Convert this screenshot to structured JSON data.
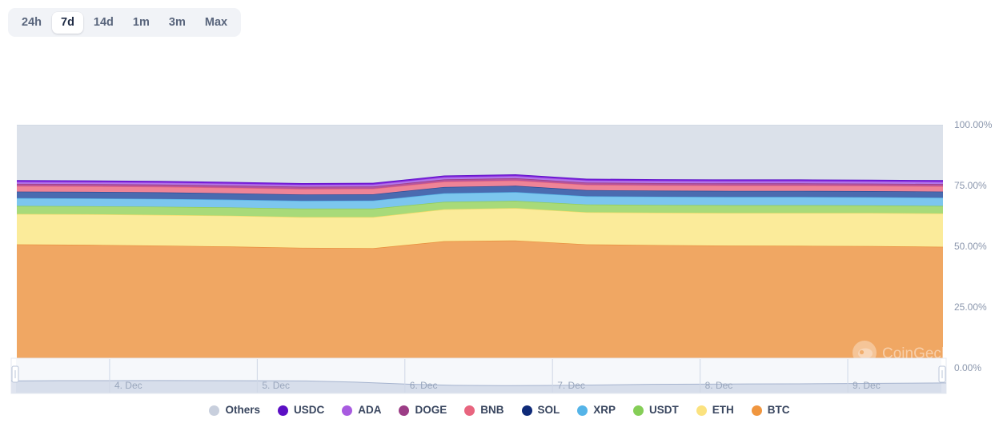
{
  "range_selector": {
    "options": [
      {
        "label": "24h",
        "active": false
      },
      {
        "label": "7d",
        "active": true
      },
      {
        "label": "14d",
        "active": false
      },
      {
        "label": "1m",
        "active": false
      },
      {
        "label": "3m",
        "active": false
      },
      {
        "label": "Max",
        "active": false
      }
    ]
  },
  "watermark": {
    "text": "CoinGecko",
    "icon": "gecko-logo-icon"
  },
  "navigator": {
    "x_labels": [
      "4. Dec",
      "5. Dec",
      "6. Dec",
      "7. Dec",
      "8. Dec",
      "9. Dec"
    ],
    "left_handle": "navigator-left-handle",
    "right_handle": "navigator-right-handle",
    "series_values": [
      76,
      76.3,
      76.4,
      76.5,
      76.4,
      76.2,
      76.0,
      74.5,
      72.0,
      70.4,
      70.0,
      70.2,
      70.9,
      71.6,
      71.9,
      72.1,
      72.3,
      72.6,
      73.0,
      73.4
    ],
    "fill_color": "#dfe4ef",
    "line_color": "#a9b6d0"
  },
  "legend": {
    "items": [
      {
        "label": "Others",
        "color": "#c8cfdd"
      },
      {
        "label": "USDC",
        "color": "#5b0fc4"
      },
      {
        "label": "ADA",
        "color": "#a85be0"
      },
      {
        "label": "DOGE",
        "color": "#9c3d86"
      },
      {
        "label": "BNB",
        "color": "#e8657f"
      },
      {
        "label": "SOL",
        "color": "#0f2a78"
      },
      {
        "label": "XRP",
        "color": "#55b4e8"
      },
      {
        "label": "USDT",
        "color": "#85ce57"
      },
      {
        "label": "ETH",
        "color": "#fbe27f"
      },
      {
        "label": "BTC",
        "color": "#f0963f"
      }
    ]
  },
  "chart_data": {
    "type": "area",
    "title": "",
    "subtitle": "",
    "xlabel": "",
    "ylabel": "",
    "stacked": true,
    "stack_mode": "percent",
    "grid": false,
    "legend_position": "bottom",
    "ylim": [
      0,
      100
    ],
    "y_ticks": [
      0,
      25,
      50,
      75,
      100
    ],
    "y_tick_labels": [
      "0.00%",
      "25.00%",
      "50.00%",
      "75.00%",
      "100.00%"
    ],
    "x_tick_labels": [
      "4. Dec",
      "5. Dec",
      "6. Dec",
      "7. Dec",
      "8. Dec",
      "9. Dec"
    ],
    "x": [
      "3. Dec",
      "3. Dec 12:00",
      "4. Dec",
      "4. Dec 12:00",
      "5. Dec",
      "5. Dec 12:00",
      "6. Dec",
      "6. Dec 12:00",
      "7. Dec",
      "7. Dec 12:00",
      "8. Dec",
      "8. Dec 12:00",
      "9. Dec",
      "9. Dec 12:00"
    ],
    "series": [
      {
        "name": "BTC",
        "color": "#f0a763",
        "stroke": "#e88f3c",
        "values": [
          50.8,
          50.6,
          50.3,
          49.9,
          49.4,
          49.2,
          52.1,
          52.4,
          50.8,
          50.5,
          50.3,
          50.2,
          50.1,
          49.8
        ]
      },
      {
        "name": "ETH",
        "color": "#fbeb9a",
        "stroke": "#f5dc6a",
        "values": [
          12.5,
          12.6,
          12.6,
          12.7,
          12.6,
          12.8,
          13.1,
          13.3,
          13.2,
          13.3,
          13.4,
          13.5,
          13.6,
          13.7
        ]
      },
      {
        "name": "USDT",
        "color": "#a8da79",
        "stroke": "#8fcc57",
        "values": [
          3.3,
          3.3,
          3.4,
          3.4,
          3.5,
          3.5,
          3.1,
          3.0,
          3.2,
          3.2,
          3.2,
          3.2,
          3.1,
          3.1
        ]
      },
      {
        "name": "XRP",
        "color": "#7cc6ee",
        "stroke": "#54b2e6",
        "values": [
          3.2,
          3.2,
          3.2,
          3.2,
          3.2,
          3.3,
          3.5,
          3.6,
          3.4,
          3.4,
          3.4,
          3.4,
          3.4,
          3.4
        ]
      },
      {
        "name": "SOL",
        "color": "#4a6bb0",
        "stroke": "#2c4a96",
        "values": [
          2.7,
          2.7,
          2.7,
          2.6,
          2.6,
          2.6,
          2.6,
          2.6,
          2.5,
          2.5,
          2.5,
          2.5,
          2.5,
          2.5
        ]
      },
      {
        "name": "BNB",
        "color": "#ee8497",
        "stroke": "#e8657f",
        "values": [
          2.3,
          2.3,
          2.3,
          2.3,
          2.3,
          2.3,
          2.2,
          2.2,
          2.2,
          2.2,
          2.2,
          2.2,
          2.2,
          2.2
        ]
      },
      {
        "name": "DOGE",
        "color": "#b5559c",
        "stroke": "#9c3d86",
        "values": [
          0.9,
          0.9,
          0.9,
          0.9,
          0.9,
          0.9,
          0.9,
          0.9,
          0.9,
          0.9,
          0.9,
          0.9,
          0.9,
          0.9
        ]
      },
      {
        "name": "ADA",
        "color": "#b276e8",
        "stroke": "#a85be0",
        "values": [
          0.8,
          0.8,
          0.8,
          0.8,
          0.8,
          0.8,
          0.9,
          0.9,
          0.9,
          0.9,
          0.9,
          0.9,
          0.9,
          0.9
        ]
      },
      {
        "name": "USDC",
        "color": "#7a20dc",
        "stroke": "#5b0fc4",
        "values": [
          0.7,
          0.7,
          0.7,
          0.7,
          0.7,
          0.7,
          0.7,
          0.7,
          0.7,
          0.7,
          0.7,
          0.7,
          0.7,
          0.7
        ]
      },
      {
        "name": "Others",
        "color": "#dbe1ea",
        "stroke": "#cfd7e3",
        "values": [
          22.8,
          22.9,
          23.1,
          23.5,
          24.0,
          23.9,
          20.9,
          20.4,
          22.2,
          22.4,
          22.5,
          22.5,
          22.6,
          22.8
        ]
      }
    ]
  }
}
